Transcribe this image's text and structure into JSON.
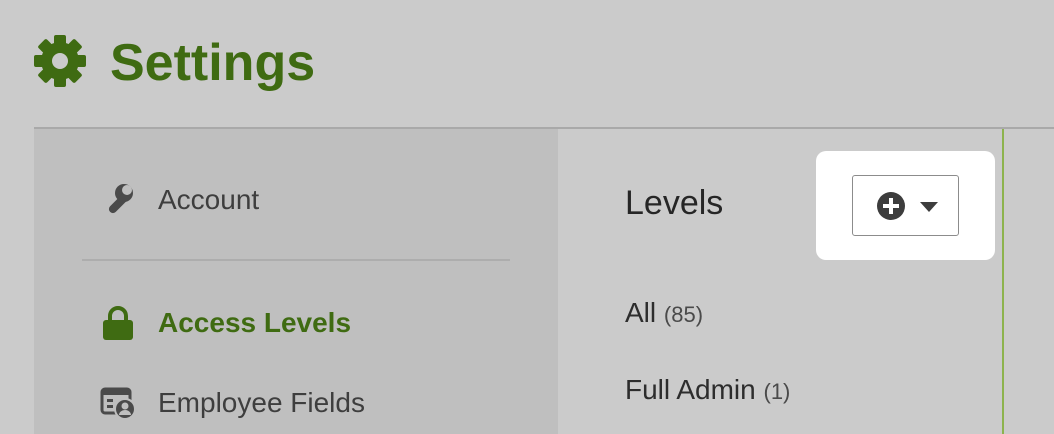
{
  "header": {
    "title": "Settings",
    "icon": "gear-icon",
    "accent_color": "#3f6b12"
  },
  "sidebar": {
    "items": [
      {
        "label": "Account",
        "icon": "wrench-icon",
        "active": false
      },
      {
        "label": "Access Levels",
        "icon": "lock-icon",
        "active": true
      },
      {
        "label": "Employee Fields",
        "icon": "employee-card-icon",
        "active": false
      }
    ]
  },
  "levels": {
    "title": "Levels",
    "add_button": {
      "icon": "plus-circle-icon",
      "dropdown_icon": "caret-down-icon"
    },
    "items": [
      {
        "label": "All",
        "count": "(85)"
      },
      {
        "label": "Full Admin",
        "count": "(1)"
      }
    ]
  }
}
